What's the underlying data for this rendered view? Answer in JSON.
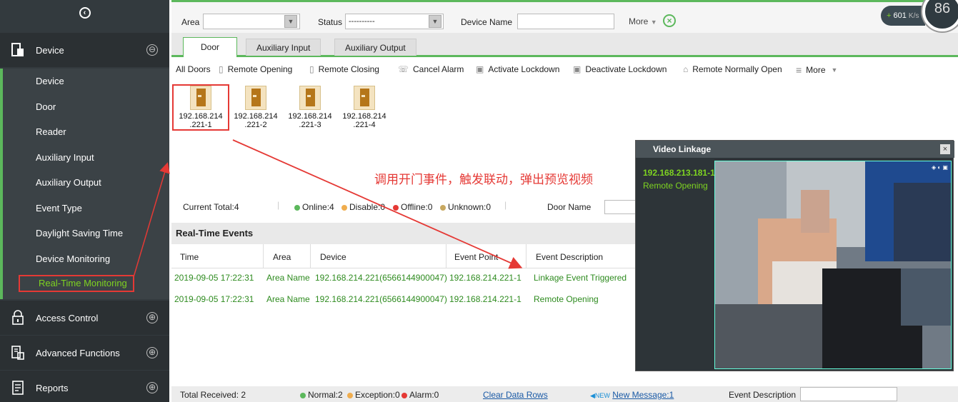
{
  "sidebar": {
    "groups": [
      {
        "label": "Device",
        "icon": "device-icon",
        "toggle": "⊖"
      },
      {
        "label": "Access Control",
        "icon": "lock-icon",
        "toggle": "⊕"
      },
      {
        "label": "Advanced Functions",
        "icon": "advanced-icon",
        "toggle": "⊕"
      },
      {
        "label": "Reports",
        "icon": "report-icon",
        "toggle": "⊕"
      }
    ],
    "items": [
      "Device",
      "Door",
      "Reader",
      "Auxiliary Input",
      "Auxiliary Output",
      "Event Type",
      "Daylight Saving Time",
      "Device Monitoring",
      "Real-Time Monitoring"
    ],
    "active_item": "Real-Time Monitoring"
  },
  "filter": {
    "area_label": "Area",
    "status_label": "Status",
    "status_value": "----------",
    "device_name_label": "Device Name",
    "more_label": "More"
  },
  "speed": {
    "value": "601",
    "unit": "K/s",
    "gauge": "86"
  },
  "tabs": [
    "Door",
    "Auxiliary Input",
    "Auxiliary Output"
  ],
  "actions": {
    "all_doors": "All Doors",
    "remote_opening": "Remote Opening",
    "remote_closing": "Remote Closing",
    "cancel_alarm": "Cancel Alarm",
    "activate_lockdown": "Activate Lockdown",
    "deactivate_lockdown": "Deactivate Lockdown",
    "remote_normally_open": "Remote Normally Open",
    "more": "More"
  },
  "doors": [
    {
      "line1": "192.168.214",
      "line2": ".221-1"
    },
    {
      "line1": "192.168.214",
      "line2": ".221-2"
    },
    {
      "line1": "192.168.214",
      "line2": ".221-3"
    },
    {
      "line1": "192.168.214",
      "line2": ".221-4"
    }
  ],
  "annotation": "调用开门事件，触发联动，弹出预览视频",
  "status": {
    "current_total": "Current Total:4",
    "online": "Online:4",
    "disable": "Disable:0",
    "offline": "Offline:0",
    "unknown": "Unknown:0",
    "door_name_label": "Door Name"
  },
  "events": {
    "title": "Real-Time Events",
    "columns": [
      "Time",
      "Area",
      "Device",
      "Event Point",
      "Event Description"
    ],
    "rows": [
      [
        "2019-09-05 17:22:31",
        "Area Name",
        "192.168.214.221(6566144900047)",
        "192.168.214.221-1",
        "Linkage Event Triggered"
      ],
      [
        "2019-09-05 17:22:31",
        "Area Name",
        "192.168.214.221(6566144900047)",
        "192.168.214.221-1",
        "Remote Opening"
      ]
    ]
  },
  "bottom": {
    "total_received": "Total Received: 2",
    "normal": "Normal:2",
    "exception": "Exception:0",
    "alarm": "Alarm:0",
    "clear": "Clear Data Rows",
    "new_message": "New Message:1",
    "event_description": "Event Description"
  },
  "video": {
    "title": "Video Linkage",
    "close": "×",
    "device": "192.168.213.181-1",
    "event": "Remote Opening"
  },
  "colors": {
    "accent": "#5cb85c",
    "sidebar": "#333a3e",
    "highlight": "#e53935",
    "event_text": "#2e8b1f"
  }
}
